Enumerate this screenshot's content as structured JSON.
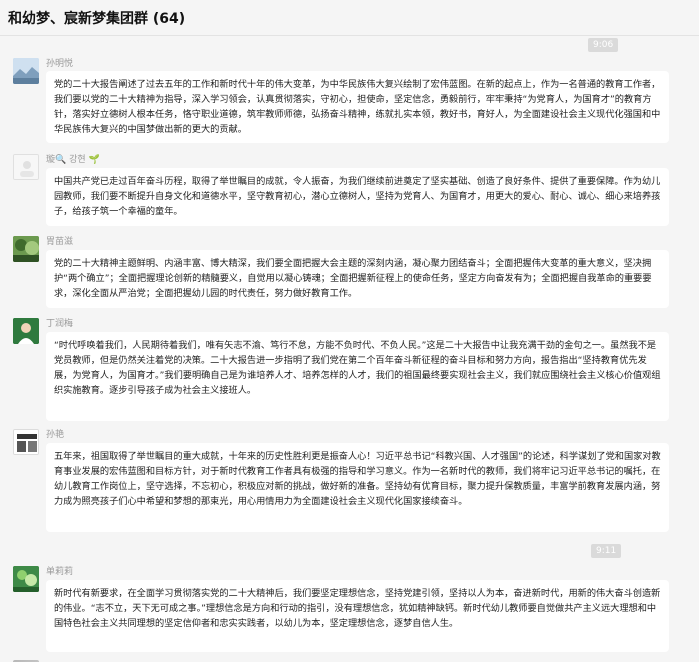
{
  "window": {
    "title": "和幼梦、宸新梦集团群 (64)"
  },
  "timestamps": [
    "9:06",
    "9:11"
  ],
  "messages": [
    {
      "sender": "孙明悦",
      "text": "党的二十大报告阐述了过去五年的工作和新时代十年的伟大变革，为中华民族伟大复兴绘制了宏伟蓝图。在新的起点上，作为一名普通的教育工作者，我们要以党的二十大精神为指导，深入学习领会，认真贯彻落实，守初心，担使命，坚定信念，勇毅前行，牢牢秉持“为党育人，为国育才”的教育方针，落实好立德树人根本任务，恪守职业道德，筑牢教师师德，弘扬奋斗精神，练就扎实本领，教好书，育好人，为全面建设社会主义现代化强国和中华民族伟大复兴的中国梦做出新的更大的贡献。"
    },
    {
      "sender": "璇🔍 강현 🌱",
      "text": "中国共产党已走过百年奋斗历程，取得了举世瞩目的成就，令人振奋，为我们继续前进奠定了坚实基础、创造了良好条件、提供了重要保障。作为幼儿园教师，我们要不断提升自身文化和道德水平，坚守教育初心，潜心立德树人，坚持为党育人、为国育才，用更大的爱心、耐心、诚心、细心来培养孩子，给孩子筑一个幸福的童年。"
    },
    {
      "sender": "胃苗滋",
      "text": "党的二十大精神主题鲜明、内涵丰富、博大精深，我们要全面把握大会主题的深刻内涵，凝心聚力团结奋斗；全面把握伟大变革的重大意义，坚决拥护“两个确立”；全面把握理论创新的精髓要义，自觉用以凝心铸魂；全面把握新征程上的使命任务，坚定方向奋发有为；全面把握自我革命的重要要求，深化全面从严治党；全面把握幼儿园的时代责任，努力做好教育工作。"
    },
    {
      "sender": "丁润梅",
      "text": "“时代呼唤着我们，人民期待着我们，唯有矢志不渝、笃行不怠，方能不负时代、不负人民。”这是二十大报告中让我充满干劲的金句之一。虽然我不是党员教师，但是仍然关注着党的决策。二十大报告进一步指明了我们党在第二个百年奋斗新征程的奋斗目标和努力方向，报告指出“坚持教育优先发展，为党育人，为国育才。”我们要明确自己是为谁培养人才、培养怎样的人才，我们的祖国最终要实现社会主义，我们就应围绕社会主义核心价值观组织实施教育。逐步引导孩子成为社会主义接班人。"
    },
    {
      "sender": "孙艳",
      "text": "五年来，祖国取得了举世瞩目的重大成就，十年来的历史性胜利更是振奋人心！习近平总书记“科教兴国、人才强国”的论述，科学谋划了党和国家对教育事业发展的宏伟蓝图和目标方针，对于新时代教育工作者具有极强的指导和学习意义。作为一名新时代的教师，我们将牢记习近平总书记的嘱托，在幼儿教育工作岗位上，坚守选择，不忘初心，积极应对新的挑战，做好新的准备。坚持幼有优育目标，聚力提升保教质量，丰富学前教育发展内涵，努力成为照亮孩子们心中希望和梦想的那束光，用心用情用力为全面建设社会主义现代化国家接续奋斗。"
    },
    {
      "sender": "单莉莉",
      "text": "新时代有新要求，在全面学习贯彻落实党的二十大精神后，我们要坚定理想信念，坚持党建引领，坚持以人为本，奋进新时代，用新的伟大奋斗创造新的伟业。“志不立，天下无可成之事。”理想信念是方向和行动的指引，没有理想信念，犹如精神缺钙。新时代幼儿教师要自觉做共产主义远大理想和中国特色社会主义共同理想的坚定信仰者和忠实实践者，以幼儿为本，坚定理想信念，逐梦自信人生。"
    },
    {
      "sender": "",
      "text": ""
    }
  ],
  "avatars": [
    "landscape-avatar",
    "blank-avatar",
    "nature-avatar",
    "portrait-avatar",
    "books-avatar",
    "plant-avatar",
    "gray-avatar"
  ]
}
